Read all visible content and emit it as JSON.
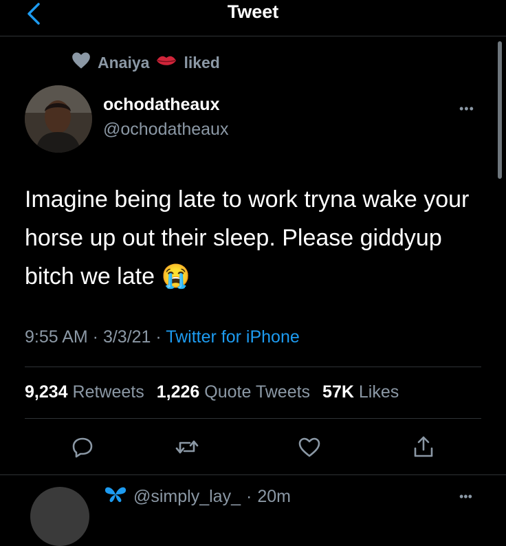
{
  "header": {
    "title": "Tweet"
  },
  "social_context": {
    "user": "Anaiya",
    "action": "liked"
  },
  "author": {
    "display_name": "ochodatheaux",
    "handle": "@ochodatheaux"
  },
  "tweet": {
    "text": "Imagine being late to work tryna wake your horse up out their sleep. Please giddyup bitch we late",
    "emoji": "😭",
    "time": "9:55 AM",
    "date": "3/3/21",
    "source": "Twitter for iPhone"
  },
  "stats": {
    "retweets_count": "9,234",
    "retweets_label": "Retweets",
    "quotes_count": "1,226",
    "quotes_label": "Quote Tweets",
    "likes_count": "57K",
    "likes_label": "Likes"
  },
  "reply": {
    "handle": "@simply_lay_",
    "time": "20m"
  },
  "more_label": "•••",
  "colors": {
    "accent": "#1d9bf0",
    "secondary_text": "#8b98a5",
    "background": "#000000"
  },
  "icons": [
    "back-chevron-icon",
    "heart-icon",
    "lips-icon",
    "reply-icon",
    "retweet-icon",
    "like-icon",
    "share-icon",
    "butterfly-icon",
    "more-icon"
  ]
}
